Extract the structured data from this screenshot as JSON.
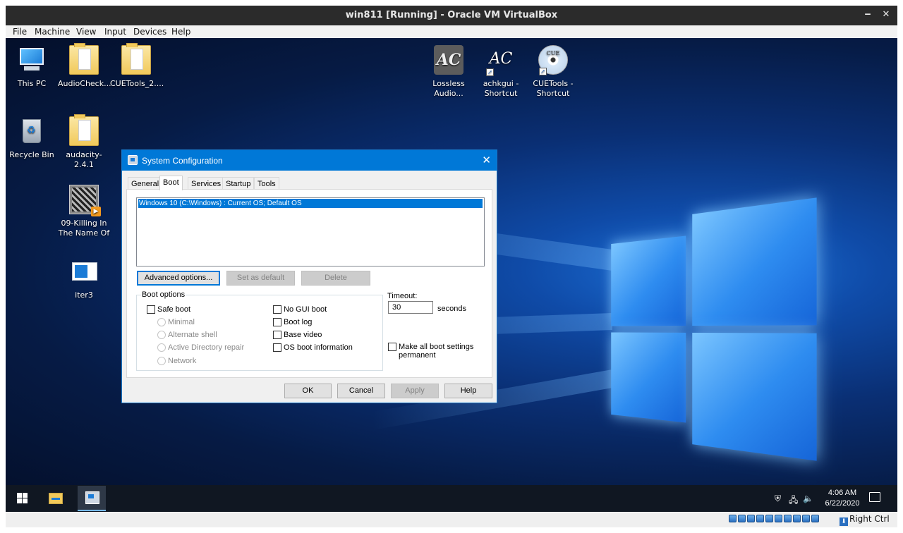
{
  "host": {
    "title": "win811 [Running] - Oracle VM VirtualBox",
    "minimize": "‒",
    "close": "✕",
    "menu": [
      "File",
      "Machine",
      "View",
      "Input",
      "Devices",
      "Help"
    ],
    "host_key": "Right Ctrl"
  },
  "desktop": {
    "icons": [
      {
        "label": "This PC",
        "icon": "computer-icon"
      },
      {
        "label": "AudioCheck...",
        "icon": "folder-icon"
      },
      {
        "label": "CUETools_2....",
        "icon": "folder-icon"
      },
      {
        "label": "Recycle Bin",
        "icon": "recycle-bin-icon"
      },
      {
        "label": "audacity-2.4.1",
        "icon": "folder-icon"
      },
      {
        "label": "09-Killing In The Name Of",
        "icon": "video-thumbnail-icon"
      },
      {
        "label": "iter3",
        "icon": "window-app-icon"
      },
      {
        "label": "Lossless Audio...",
        "icon": "lac-icon"
      },
      {
        "label": "achkgui - Shortcut",
        "icon": "achk-icon"
      },
      {
        "label": "CUETools - Shortcut",
        "icon": "cue-disc-icon"
      }
    ],
    "lac_glyph": "AC",
    "achk_glyph": "AC",
    "cue_glyph": "CUE"
  },
  "dialog": {
    "title": "System Configuration",
    "close": "✕",
    "tabs": [
      "General",
      "Boot",
      "Services",
      "Startup",
      "Tools"
    ],
    "active_tab": "Boot",
    "os_list": [
      "Windows 10 (C:\\Windows) : Current OS; Default OS"
    ],
    "buttons": {
      "advanced": "Advanced options...",
      "set_default": "Set as default",
      "delete": "Delete",
      "ok": "OK",
      "cancel": "Cancel",
      "apply": "Apply",
      "help": "Help"
    },
    "boot_options_label": "Boot options",
    "safe_boot": "Safe boot",
    "radios": [
      "Minimal",
      "Alternate shell",
      "Active Directory repair",
      "Network"
    ],
    "checks": [
      "No GUI boot",
      "Boot log",
      "Base video",
      "OS boot information"
    ],
    "timeout_label": "Timeout:",
    "timeout_value": "30",
    "seconds": "seconds",
    "make_permanent": [
      "Make all boot settings",
      "permanent"
    ]
  },
  "taskbar": {
    "time": "4:06 AM",
    "date": "6/22/2020"
  },
  "colors": {
    "accent": "#0078d7",
    "taskbar": "#101722",
    "host_titlebar": "#2b2b2b"
  }
}
